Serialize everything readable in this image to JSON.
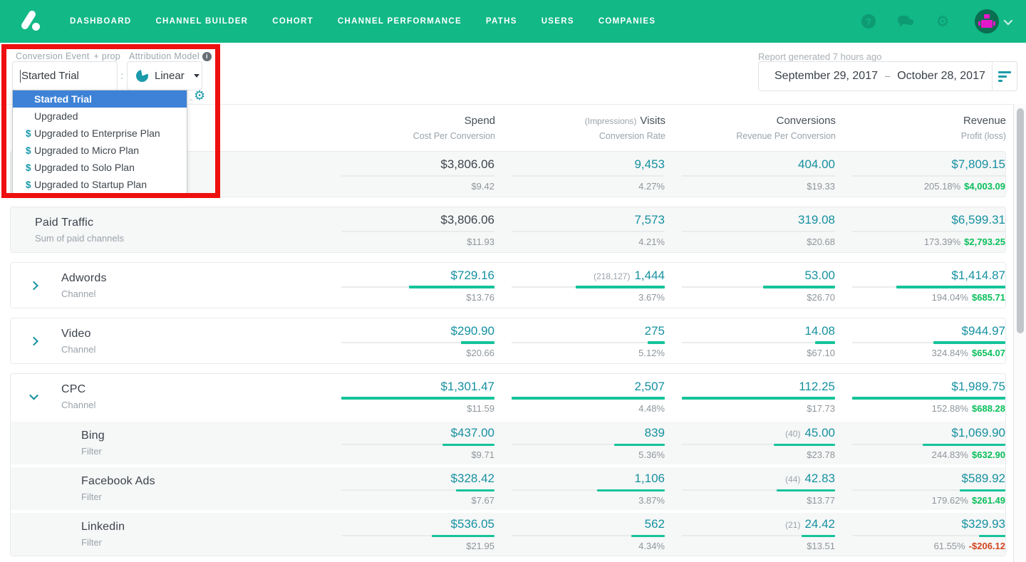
{
  "colors": {
    "brand_green": "#12b886",
    "link_teal": "#1691a0",
    "bar_green": "#15c39a",
    "profit_green": "#0abf5b",
    "loss_red": "#d2451e",
    "highlight_blue": "#3d82d6",
    "annotation_red": "#ee0f0f",
    "accent_teal_icon": "#1a9aaa"
  },
  "icons": {
    "help_glyph": "?",
    "info_glyph": "i",
    "gear_glyph": "⚙",
    "dollar_glyph": "$"
  },
  "nav": {
    "items": [
      {
        "label": "DASHBOARD"
      },
      {
        "label": "CHANNEL BUILDER"
      },
      {
        "label": "COHORT"
      },
      {
        "label": "CHANNEL PERFORMANCE"
      },
      {
        "label": "PATHS"
      },
      {
        "label": "USERS"
      },
      {
        "label": "COMPANIES"
      }
    ]
  },
  "controls": {
    "conversion_event_label": "Conversion Event",
    "conversion_event_prop": "+ prop",
    "conversion_event_value": "Started Trial",
    "separator": ":",
    "attribution_model_label": "Attribution Model",
    "attribution_model_value": "Linear",
    "dropdown_options": [
      {
        "label": "Started Trial",
        "selected": true,
        "dollar": false
      },
      {
        "label": "Upgraded",
        "selected": false,
        "dollar": false
      },
      {
        "label": "Upgraded to Enterprise Plan",
        "selected": false,
        "dollar": true
      },
      {
        "label": "Upgraded to Micro Plan",
        "selected": false,
        "dollar": true
      },
      {
        "label": "Upgraded to Solo Plan",
        "selected": false,
        "dollar": true
      },
      {
        "label": "Upgraded to Startup Plan",
        "selected": false,
        "dollar": true
      }
    ]
  },
  "report": {
    "generated": "Report generated 7 hours ago",
    "date_start": "September 29, 2017",
    "date_separator": "–",
    "date_end": "October 28, 2017"
  },
  "table": {
    "headers": [
      {
        "pre": "",
        "top": "Spend",
        "sub": "Cost Per Conversion"
      },
      {
        "pre": "(Impressions)",
        "top": "Visits",
        "sub": "Conversion Rate"
      },
      {
        "pre": "",
        "top": "Conversions",
        "sub": "Revenue Per Conversion"
      },
      {
        "pre": "",
        "top": "Revenue",
        "sub": "Profit (loss)"
      }
    ],
    "cards": [
      {
        "rows": [
          {
            "name": "",
            "subtitle": "",
            "style": "summary",
            "chevron": "",
            "cells": [
              {
                "pre": "",
                "top": "$3,806.06",
                "sub": "$9.42",
                "bar": 0,
                "muted": true
              },
              {
                "pre": "",
                "top": "9,453",
                "sub": "4.27%",
                "bar": 0
              },
              {
                "pre": "",
                "top": "404.00",
                "sub": "$19.33",
                "bar": 0
              },
              {
                "pre": "",
                "top": "$7,809.15",
                "sub": "205.18%",
                "profit": "$4,003.09",
                "profit_neg": false,
                "bar": 0
              }
            ]
          }
        ]
      },
      {
        "rows": [
          {
            "name": "Paid Traffic",
            "subtitle": "Sum of paid channels",
            "style": "summary",
            "chevron": "",
            "cells": [
              {
                "pre": "",
                "top": "$3,806.06",
                "sub": "$11.93",
                "bar": 0,
                "muted": true
              },
              {
                "pre": "",
                "top": "7,573",
                "sub": "4.21%",
                "bar": 0
              },
              {
                "pre": "",
                "top": "319.08",
                "sub": "$20.68",
                "bar": 0
              },
              {
                "pre": "",
                "top": "$6,599.31",
                "sub": "173.39%",
                "profit": "$2,793.25",
                "profit_neg": false,
                "bar": 0
              }
            ]
          }
        ]
      },
      {
        "rows": [
          {
            "name": "Adwords",
            "subtitle": "Channel",
            "style": "channel",
            "chevron": "right",
            "cells": [
              {
                "pre": "",
                "top": "$729.16",
                "sub": "$13.76",
                "bar": 56
              },
              {
                "pre": "(218,127)",
                "top": "1,444",
                "sub": "3.67%",
                "bar": 58
              },
              {
                "pre": "",
                "top": "53.00",
                "sub": "$26.70",
                "bar": 47
              },
              {
                "pre": "",
                "top": "$1,414.87",
                "sub": "194.04%",
                "profit": "$685.71",
                "profit_neg": false,
                "bar": 71
              }
            ]
          }
        ]
      },
      {
        "rows": [
          {
            "name": "Video",
            "subtitle": "Channel",
            "style": "channel",
            "chevron": "right",
            "cells": [
              {
                "pre": "",
                "top": "$290.90",
                "sub": "$20.66",
                "bar": 22
              },
              {
                "pre": "",
                "top": "275",
                "sub": "5.12%",
                "bar": 11
              },
              {
                "pre": "",
                "top": "14.08",
                "sub": "$67.10",
                "bar": 13
              },
              {
                "pre": "",
                "top": "$944.97",
                "sub": "324.84%",
                "profit": "$654.07",
                "profit_neg": false,
                "bar": 47
              }
            ]
          }
        ]
      },
      {
        "rows": [
          {
            "name": "CPC",
            "subtitle": "Channel",
            "style": "channel",
            "chevron": "down",
            "cells": [
              {
                "pre": "",
                "top": "$1,301.47",
                "sub": "$11.59",
                "bar": 100
              },
              {
                "pre": "",
                "top": "2,507",
                "sub": "4.48%",
                "bar": 100
              },
              {
                "pre": "",
                "top": "112.25",
                "sub": "$17.73",
                "bar": 100
              },
              {
                "pre": "",
                "top": "$1,989.75",
                "sub": "152.88%",
                "profit": "$688.28",
                "profit_neg": false,
                "bar": 100
              }
            ]
          },
          {
            "name": "Bing",
            "subtitle": "Filter",
            "style": "filter",
            "chevron": "",
            "cells": [
              {
                "pre": "",
                "top": "$437.00",
                "sub": "$9.71",
                "bar": 34
              },
              {
                "pre": "",
                "top": "839",
                "sub": "5.36%",
                "bar": 33
              },
              {
                "pre": "(40)",
                "top": "45.00",
                "sub": "$23.78",
                "bar": 40
              },
              {
                "pre": "",
                "top": "$1,069.90",
                "sub": "244.83%",
                "profit": "$632.90",
                "profit_neg": false,
                "bar": 54
              }
            ]
          },
          {
            "name": "Facebook Ads",
            "subtitle": "Filter",
            "style": "filter",
            "chevron": "",
            "cells": [
              {
                "pre": "",
                "top": "$328.42",
                "sub": "$7.67",
                "bar": 25
              },
              {
                "pre": "",
                "top": "1,106",
                "sub": "3.87%",
                "bar": 44
              },
              {
                "pre": "(44)",
                "top": "42.83",
                "sub": "$13.77",
                "bar": 38
              },
              {
                "pre": "",
                "top": "$589.92",
                "sub": "179.62%",
                "profit": "$261.49",
                "profit_neg": false,
                "bar": 30
              }
            ]
          },
          {
            "name": "Linkedin",
            "subtitle": "Filter",
            "style": "filter",
            "chevron": "",
            "cells": [
              {
                "pre": "",
                "top": "$536.05",
                "sub": "$21.95",
                "bar": 41
              },
              {
                "pre": "",
                "top": "562",
                "sub": "4.34%",
                "bar": 22
              },
              {
                "pre": "(21)",
                "top": "24.42",
                "sub": "$13.51",
                "bar": 22
              },
              {
                "pre": "",
                "top": "$329.93",
                "sub": "61.55%",
                "profit": "-$206.12",
                "profit_neg": true,
                "bar": 17
              }
            ]
          }
        ]
      }
    ]
  }
}
